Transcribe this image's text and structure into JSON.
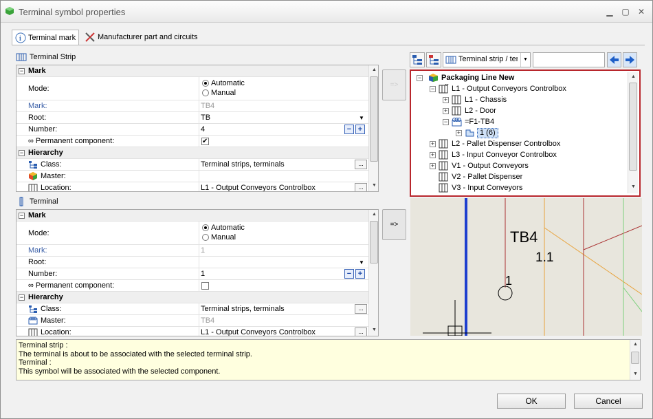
{
  "window": {
    "title": "Terminal symbol properties",
    "minimize_glyph": "▁",
    "restore_glyph": "▢",
    "close_glyph": "✕"
  },
  "tabs": [
    {
      "label": "Terminal mark",
      "icon": "info-icon"
    },
    {
      "label": "Manufacturer part and circuits",
      "icon": "tools-icon"
    }
  ],
  "terminal_strip": {
    "header": "Terminal Strip",
    "mark_group": "Mark",
    "mode_label": "Mode:",
    "mode_options": [
      "Automatic",
      "Manual"
    ],
    "mode_selected": "Automatic",
    "mark_label": "Mark:",
    "mark_value": "TB4",
    "root_label": "Root:",
    "root_value": "TB",
    "number_label": "Number:",
    "number_value": "4",
    "permanent_label": "Permanent component:",
    "permanent_checked": true,
    "hierarchy_group": "Hierarchy",
    "class_label": "Class:",
    "class_value": "Terminal strips, terminals",
    "master_label": "Master:",
    "master_value": "",
    "location_label": "Location:",
    "location_value": "L1 - Output Conveyors Controlbox"
  },
  "terminal": {
    "header": "Terminal",
    "mark_group": "Mark",
    "mode_label": "Mode:",
    "mode_options": [
      "Automatic",
      "Manual"
    ],
    "mode_selected": "Automatic",
    "mark_label": "Mark:",
    "mark_value": "1",
    "root_label": "Root:",
    "root_value": "",
    "number_label": "Number:",
    "number_value": "1",
    "permanent_label": "Permanent component:",
    "permanent_checked": false,
    "hierarchy_group": "Hierarchy",
    "class_label": "Class:",
    "class_value": "Terminal strips, terminals",
    "master_label": "Master:",
    "master_value": "TB4",
    "location_label": "Location:",
    "location_value": "L1 - Output Conveyors Controlbox"
  },
  "assoc_button_label": "=>",
  "ellipsis_label": "...",
  "tree_toolbar": {
    "filter_selected": "Terminal strip / ten",
    "search_value": ""
  },
  "tree": {
    "root": "Packaging Line New",
    "items": [
      {
        "label": "L1 - Output Conveyors Controlbox",
        "level": 1,
        "expander": "−"
      },
      {
        "label": "L1 - Chassis",
        "level": 2,
        "expander": "+"
      },
      {
        "label": "L2 - Door",
        "level": 2,
        "expander": "+"
      },
      {
        "label": "=F1-TB4",
        "level": 2,
        "expander": "−"
      },
      {
        "label": "1 (6)",
        "level": 3,
        "expander": "+"
      },
      {
        "label": "L2 - Pallet Dispenser Controlbox",
        "level": 1,
        "expander": "+"
      },
      {
        "label": "L3 - Input Conveyor Controlbox",
        "level": 1,
        "expander": "+"
      },
      {
        "label": "V1 - Output Conveyors",
        "level": 1,
        "expander": "+"
      },
      {
        "label": "V2 - Pallet Dispenser",
        "level": 1,
        "expander": ""
      },
      {
        "label": "V3 - Input Conveyors",
        "level": 1,
        "expander": ""
      }
    ]
  },
  "drawing": {
    "tb_label": "TB4",
    "sub_label": "1.1",
    "terminal_label": "1"
  },
  "info_lines": [
    "Terminal strip :",
    "The terminal is about to be associated with the selected terminal strip.",
    "Terminal :",
    "This symbol will be associated with the selected component."
  ],
  "buttons": {
    "ok": "OK",
    "cancel": "Cancel"
  },
  "colors": {
    "accent_border": "#b8262c",
    "selected_bg": "#cfe1f7"
  }
}
